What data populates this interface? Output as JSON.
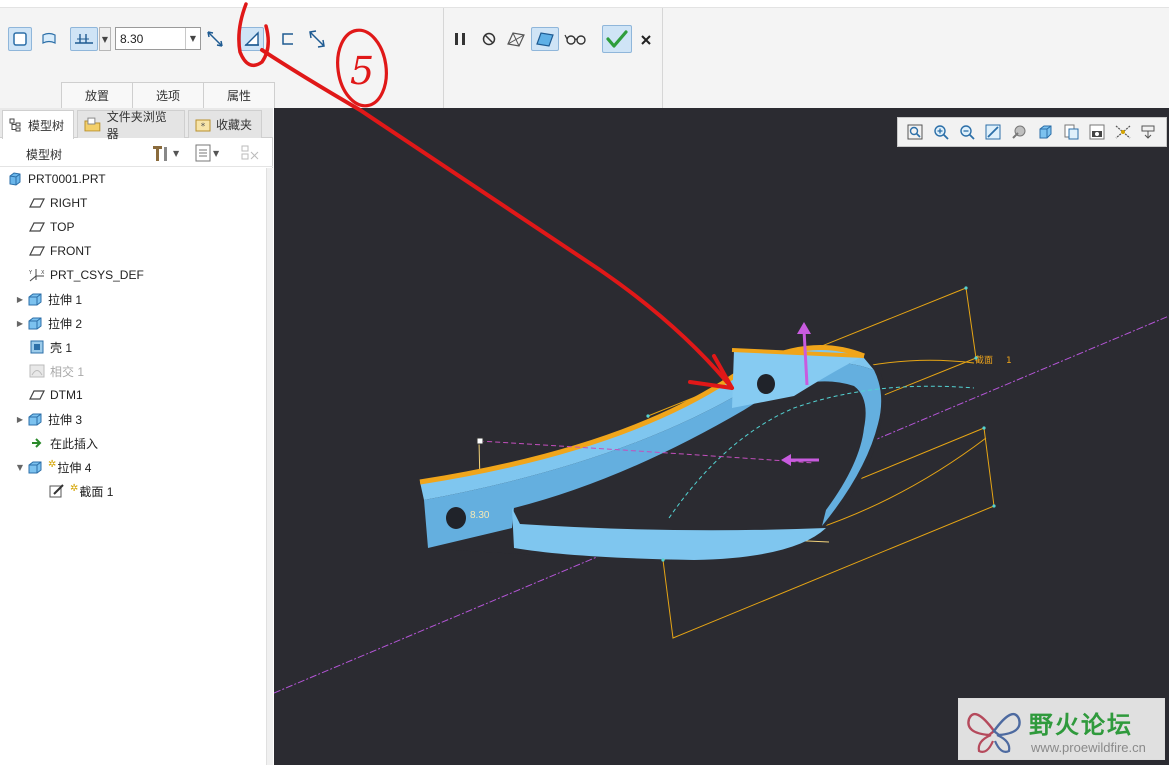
{
  "ribbon": {
    "depth_value": "8.30",
    "tabs": [
      {
        "label": "放置"
      },
      {
        "label": "选项"
      },
      {
        "label": "属性"
      }
    ]
  },
  "panel": {
    "tabs": [
      {
        "label": "模型树"
      },
      {
        "label": "文件夹浏览器"
      },
      {
        "label": "收藏夹"
      }
    ],
    "tree_title": "模型树"
  },
  "tree": {
    "items": [
      {
        "label": "PRT0001.PRT",
        "icon": "part-icon"
      },
      {
        "label": "RIGHT",
        "icon": "datum-plane-icon"
      },
      {
        "label": "TOP",
        "icon": "datum-plane-icon"
      },
      {
        "label": "FRONT",
        "icon": "datum-plane-icon"
      },
      {
        "label": "PRT_CSYS_DEF",
        "icon": "csys-icon"
      },
      {
        "label": "拉伸 1",
        "icon": "extrude-icon"
      },
      {
        "label": "拉伸 2",
        "icon": "extrude-icon"
      },
      {
        "label": "壳 1",
        "icon": "shell-icon"
      },
      {
        "label": "相交 1",
        "icon": "intersect-icon"
      },
      {
        "label": "DTM1",
        "icon": "datum-plane-icon"
      },
      {
        "label": "拉伸 3",
        "icon": "extrude-icon"
      },
      {
        "label": "在此插入",
        "icon": "insert-here-icon"
      },
      {
        "label": "拉伸 4",
        "icon": "extrude-icon"
      },
      {
        "label": "截面 1",
        "icon": "sketch-icon"
      }
    ]
  },
  "scene": {
    "dim_text": "8.30",
    "section_label": "截面",
    "section_suffix": "1"
  },
  "watermark": {
    "title": "野火论坛",
    "url": "www.proewildfire.cn"
  },
  "annotation": {
    "number": "5",
    "color": "#e01818"
  },
  "colors": {
    "viewport_bg": "#2b2b31",
    "part_fill": "#7fc6ef",
    "edge_orange": "#f0a51a",
    "sketch_yellow": "#e6a515",
    "datum_axis": "#b455d6",
    "confirm_green": "#2e9d3c"
  }
}
